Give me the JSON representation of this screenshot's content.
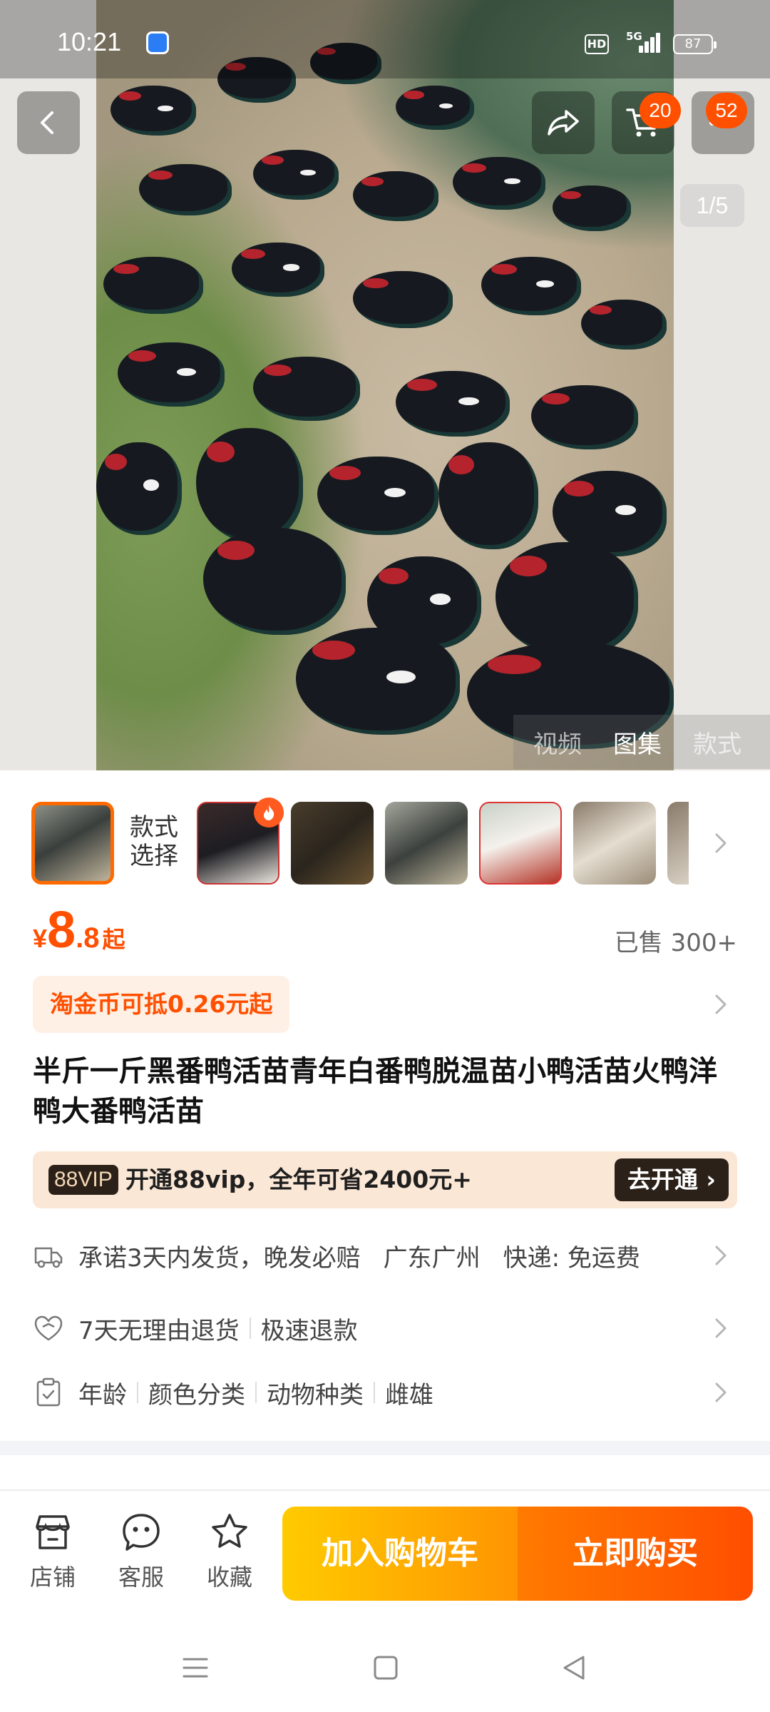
{
  "status_bar": {
    "time": "10:21",
    "hd": "HD",
    "network": "5G",
    "battery": "87"
  },
  "hero": {
    "pager": "1/5",
    "media_tabs": [
      "视频",
      "图集",
      "款式"
    ],
    "active_media_tab": "图集"
  },
  "top_actions": {
    "cart_badge": "20",
    "more_badge": "52"
  },
  "thumbs": {
    "style_select_line1": "款式",
    "style_select_line2": "选择",
    "count": 7
  },
  "price": {
    "currency": "¥",
    "integer": "8",
    "decimal": ".8",
    "suffix": "起",
    "sold": "已售 300+",
    "color": "#ff4f00"
  },
  "coin": {
    "text": "淘金币可抵0.26元起"
  },
  "product": {
    "title": "半斤一斤黑番鸭活苗青年白番鸭脱温苗小鸭活苗火鸭洋鸭大番鸭活苗"
  },
  "vip": {
    "tag": "88VIP",
    "text": "开通88vip，全年可省2400元+",
    "button": "去开通"
  },
  "rows": {
    "shipping": {
      "icon": "truck-icon",
      "promise": "承诺3天内发货，晚发必赔",
      "location": "广东广州",
      "express": "快递: 免运费"
    },
    "returns": {
      "icon": "shield-heart-icon",
      "policy": "7天无理由退货",
      "refund": "极速退款"
    },
    "specs": {
      "icon": "clipboard-icon",
      "items": [
        "年龄",
        "颜色分类",
        "动物种类",
        "雌雄"
      ]
    }
  },
  "bottom_bar": {
    "shop": "店铺",
    "service": "客服",
    "favorite": "收藏",
    "add_to_cart": "加入购物车",
    "buy_now": "立即购买"
  },
  "colors": {
    "accent": "#ff5000",
    "cart_gradient_start": "#ffcb00",
    "buy_gradient_end": "#ff4e00"
  }
}
